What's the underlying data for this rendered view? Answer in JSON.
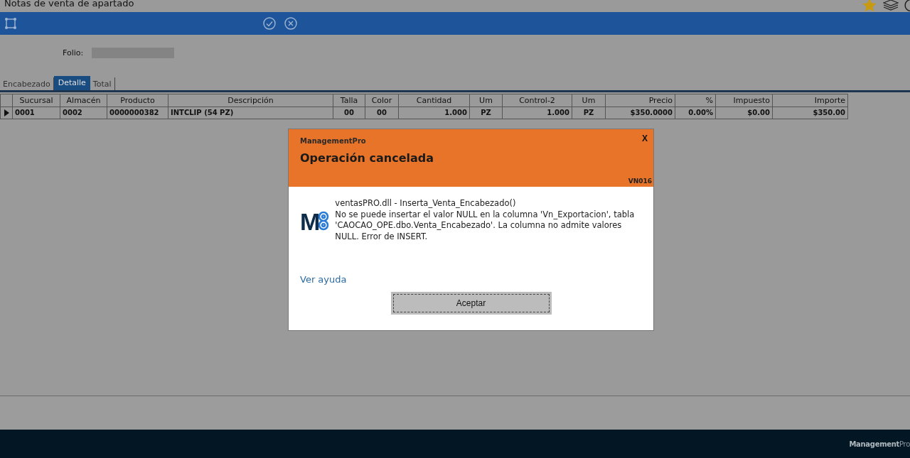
{
  "window": {
    "title": "Notas de venta de apartado"
  },
  "folio": {
    "label": "Folio:"
  },
  "tabs": [
    {
      "label": "Encabezado",
      "selected": false
    },
    {
      "label": "Detalle",
      "selected": true
    },
    {
      "label": "Total",
      "selected": false
    }
  ],
  "table": {
    "columns": [
      "Sucursal",
      "Almacén",
      "Producto",
      "Descripción",
      "Talla",
      "Color",
      "Cantidad",
      "Um",
      "Control-2",
      "Um",
      "Precio",
      "%",
      "Impuesto",
      "Importe"
    ],
    "rows": [
      {
        "current": true,
        "cells": [
          "0001",
          "0002",
          "0000000382",
          "INTCLIP (54 PZ)",
          "00",
          "00",
          "1.000",
          "PZ",
          "1.000",
          "PZ",
          "$350.0000",
          "0.00%",
          "$0.00",
          "$350.00"
        ]
      }
    ]
  },
  "dialog": {
    "app": "ManagementPro",
    "close": "X",
    "title": "Operación cancelada",
    "code": "VN016",
    "logo": "M",
    "source": "ventasPRO.dll - Inserta_Venta_Encabezado()",
    "message": "No se puede insertar el valor NULL en la columna 'Vn_Exportacion', tabla 'CAOCAO_OPE.dbo.Venta_Encabezado'. La columna no admite valores NULL. Error de INSERT.",
    "help_link": "Ver ayuda",
    "button": "Aceptar"
  },
  "footer": {
    "brand": "**Management**Pro"
  }
}
